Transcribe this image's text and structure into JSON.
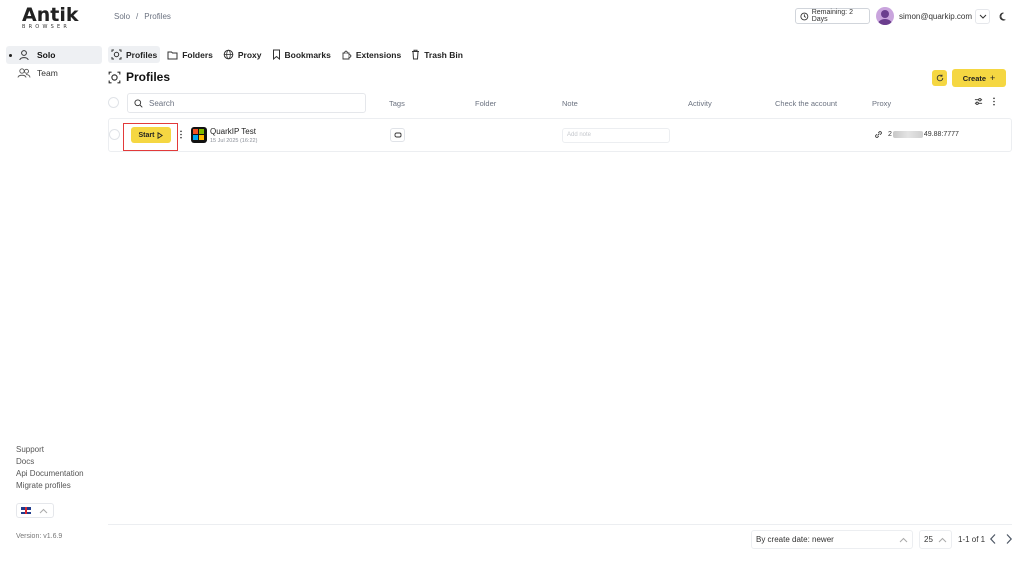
{
  "app": {
    "logo_text": "Antik",
    "logo_sub": "BROWSER",
    "version": "Version: v1.6.9"
  },
  "breadcrumb": {
    "items": [
      "Solo",
      "/",
      "Profiles"
    ]
  },
  "topbar": {
    "remaining": "Remaining: 2 Days",
    "email": "simon@quarkip.com"
  },
  "sidebar": {
    "items": [
      {
        "label": "Solo",
        "icon": "user-icon",
        "active": true
      },
      {
        "label": "Team",
        "icon": "team-icon",
        "active": false
      }
    ],
    "links": [
      "Support",
      "Docs",
      "Api Documentation",
      "Migrate profiles"
    ],
    "language_flag": "uk-flag-icon"
  },
  "tabs": [
    {
      "label": "Profiles",
      "icon": "profiles-icon",
      "active": true
    },
    {
      "label": "Folders",
      "icon": "folder-icon",
      "active": false
    },
    {
      "label": "Proxy",
      "icon": "proxy-icon",
      "active": false
    },
    {
      "label": "Bookmarks",
      "icon": "bookmark-icon",
      "active": false
    },
    {
      "label": "Extensions",
      "icon": "extensions-icon",
      "active": false
    },
    {
      "label": "Trash Bin",
      "icon": "trash-icon",
      "active": false
    }
  ],
  "page": {
    "title": "Profiles",
    "create_label": "Create",
    "create_icon": "+"
  },
  "table": {
    "search_placeholder": "Search",
    "columns": {
      "tags": "Tags",
      "folder": "Folder",
      "note": "Note",
      "activity": "Activity",
      "check": "Check the account",
      "proxy": "Proxy"
    },
    "rows": [
      {
        "start_label": "Start",
        "name": "QuarkIP Test",
        "date": "15 Jul 2025 (16:22)",
        "note_placeholder": "Add note",
        "proxy_prefix": "2",
        "proxy_suffix": "49.88:7777"
      }
    ]
  },
  "footer": {
    "sort": "By create date: newer",
    "per_page": "25",
    "range": "1-1 of 1"
  },
  "colors": {
    "accent": "#f5d742",
    "highlight_border": "#e23a3a",
    "active_bg": "#eef0f3"
  }
}
